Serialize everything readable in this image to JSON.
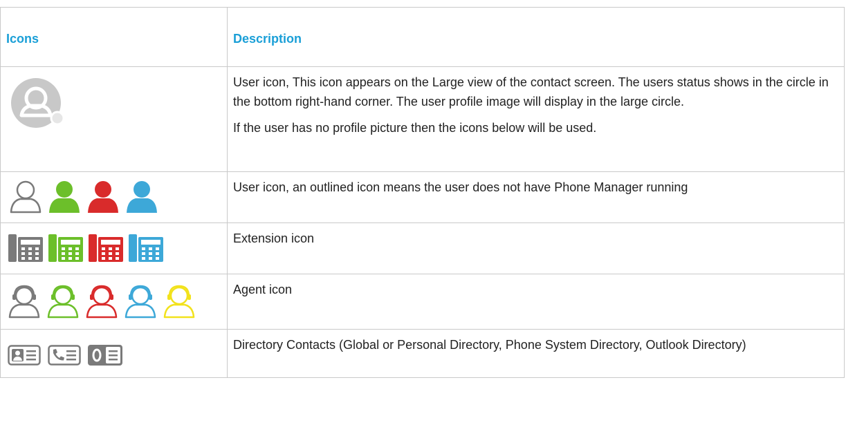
{
  "table": {
    "header": {
      "icons": "Icons",
      "description": "Description"
    },
    "rows": [
      {
        "icons": [
          "user-profile-avatar-icon"
        ],
        "description": [
          "User icon, This icon appears on the Large view of the contact screen. The users status shows in the circle in the bottom right-hand corner. The user profile image will display in the large circle.",
          "If the user has no profile picture then the icons below will be used."
        ]
      },
      {
        "icons": [
          "user-outline-icon",
          "user-green-icon",
          "user-red-icon",
          "user-blue-icon"
        ],
        "description": [
          "User icon, an outlined icon means the user does not have Phone Manager running"
        ]
      },
      {
        "icons": [
          "extension-grey-icon",
          "extension-green-icon",
          "extension-red-icon",
          "extension-blue-icon"
        ],
        "description": [
          "Extension icon"
        ]
      },
      {
        "icons": [
          "agent-grey-icon",
          "agent-green-icon",
          "agent-red-icon",
          "agent-blue-icon",
          "agent-yellow-icon"
        ],
        "description": [
          "Agent icon"
        ]
      },
      {
        "icons": [
          "contact-card-icon",
          "phone-directory-icon",
          "outlook-directory-icon"
        ],
        "description": [
          "Directory Contacts (Global or Personal Directory, Phone System Directory, Outlook Directory)"
        ]
      }
    ]
  },
  "colors": {
    "header_text": "#1a9fd7",
    "grey": "#7a7a7a",
    "green": "#6cbf2a",
    "red": "#d92b2b",
    "blue": "#3da8d8",
    "yellow": "#f2e21c"
  }
}
